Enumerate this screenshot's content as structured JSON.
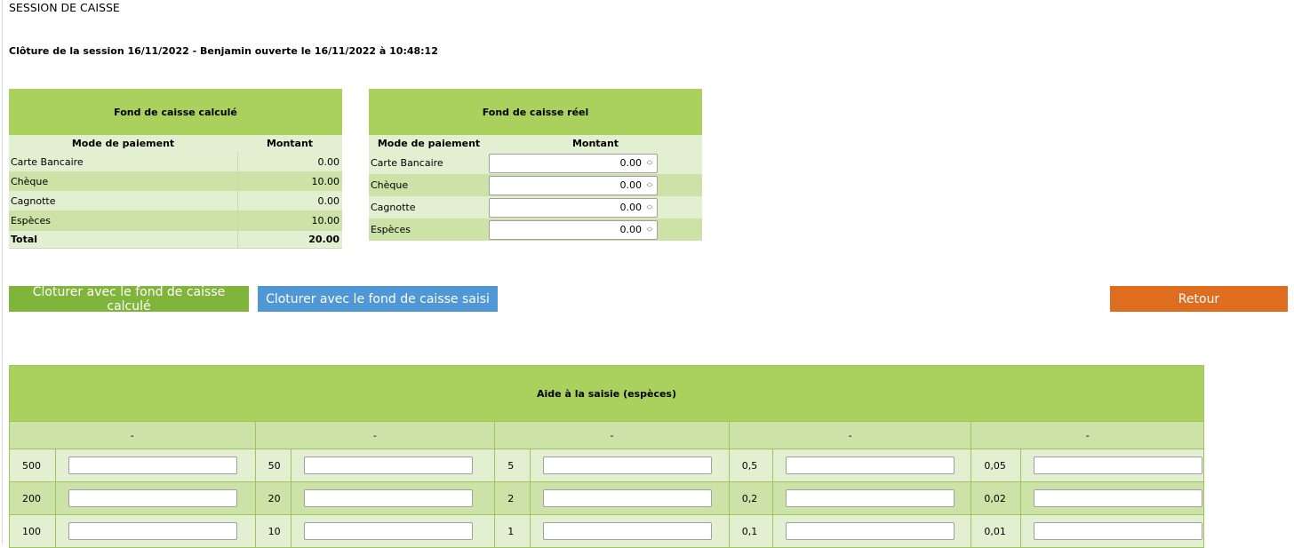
{
  "page": {
    "title": "SESSION DE CAISSE",
    "session_line": "Clôture de la session 16/11/2022 - Benjamin ouverte le 16/11/2022 à 10:48:12"
  },
  "calc_table": {
    "title": "Fond de caisse calculé",
    "col_mode": "Mode de paiement",
    "col_amount": "Montant",
    "rows": [
      {
        "label": "Carte Bancaire",
        "amount": "0.00"
      },
      {
        "label": "Chèque",
        "amount": "10.00"
      },
      {
        "label": "Cagnotte",
        "amount": "0.00"
      },
      {
        "label": "Espèces",
        "amount": "10.00"
      }
    ],
    "total_label": "Total",
    "total_amount": "20.00"
  },
  "real_table": {
    "title": "Fond de caisse réel",
    "col_mode": "Mode de paiement",
    "col_amount": "Montant",
    "rows": [
      {
        "label": "Carte Bancaire",
        "value": "0.00"
      },
      {
        "label": "Chèque",
        "value": "0.00"
      },
      {
        "label": "Cagnotte",
        "value": "0.00"
      },
      {
        "label": "Espèces",
        "value": "0.00"
      }
    ]
  },
  "buttons": {
    "close_calc": "Cloturer avec le fond de caisse calculé",
    "close_entered": "Cloturer avec le fond de caisse saisi",
    "back": "Retour"
  },
  "helper": {
    "title": "Aide à la saisie (espèces)",
    "column_headers": [
      "-",
      "-",
      "-",
      "-",
      "-"
    ],
    "rows": [
      [
        "500",
        "50",
        "5",
        "0,5",
        "0,05"
      ],
      [
        "200",
        "20",
        "2",
        "0,2",
        "0,02"
      ],
      [
        "100",
        "10",
        "1",
        "0,1",
        "0,01"
      ]
    ]
  },
  "colors": {
    "header_green": "#aad15d",
    "row_light": "#e3efd1",
    "row_dark": "#cce2a7",
    "btn_green": "#7fb53a",
    "btn_blue": "#4f97d5",
    "btn_orange": "#de6d1f"
  }
}
